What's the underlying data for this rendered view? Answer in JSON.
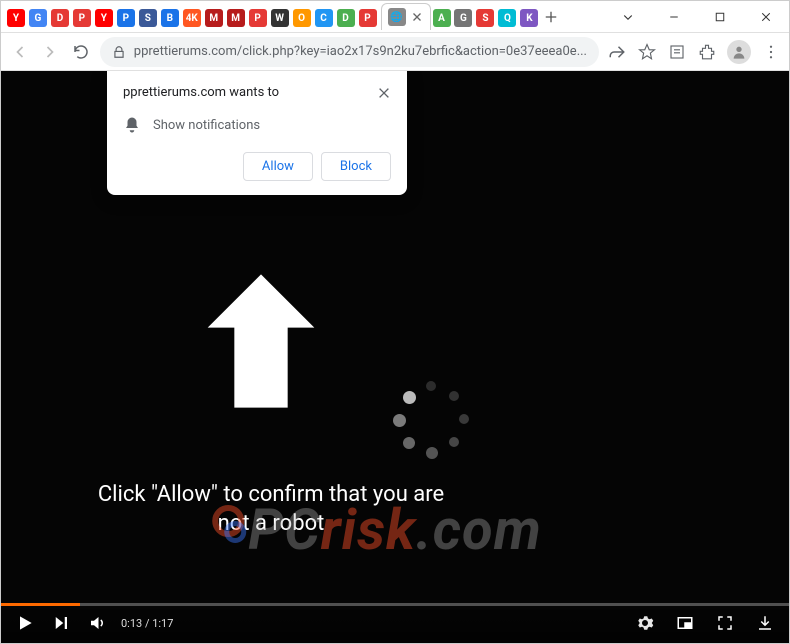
{
  "titlebar": {
    "tab_favicons": [
      "Y",
      "G",
      "D",
      "P",
      "Y",
      "P",
      "S",
      "B",
      "4K",
      "M",
      "M",
      "P",
      "W",
      "O",
      "C",
      "D",
      "P"
    ],
    "tab_colors": [
      "#f00",
      "#4285f4",
      "#e53935",
      "#e53935",
      "#f00",
      "#1a73e8",
      "#3b5998",
      "#1a73e8",
      "#ff5722",
      "#b71c1c",
      "#b71c1c",
      "#e53935",
      "#333",
      "#ff9800",
      "#2196f3",
      "#4caf50",
      "#e53935"
    ],
    "tab_after_colors": [
      "#4caf50",
      "#757575",
      "#e53935",
      "#00bcd4",
      "#7e57c2"
    ],
    "tab_after_labels": [
      "A",
      "G",
      "S",
      "Q",
      "K"
    ]
  },
  "addressbar": {
    "url": "pprettierums.com/click.php?key=iao2x17s9n2ku7ebrfic&action=0e37eeea0e..."
  },
  "popup": {
    "title": "pprettierums.com wants to",
    "body": "Show notifications",
    "allow": "Allow",
    "block": "Block"
  },
  "page": {
    "main_text": "Click \"Allow\" to confirm that you are not a robot",
    "watermark_prefix": "PC",
    "watermark_risk": "risk",
    "watermark_suffix": ".com"
  },
  "video": {
    "time": "0:13 / 1:17"
  }
}
